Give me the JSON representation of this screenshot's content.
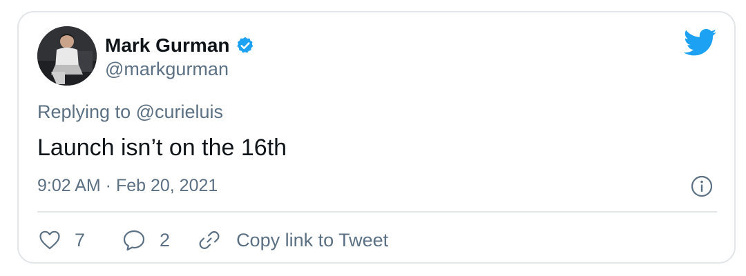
{
  "user": {
    "display_name": "Mark Gurman",
    "handle": "@markgurman",
    "verified": true,
    "avatar": "person-photo"
  },
  "tweet": {
    "replying_to": "Replying to @curieluis",
    "text": "Launch isn’t on the 16th",
    "timestamp": "9:02 AM · Feb 20, 2021"
  },
  "actions": {
    "likes": "7",
    "replies": "2",
    "copy_link": "Copy link to Tweet"
  },
  "icons": {
    "brand": "twitter-bird-icon",
    "verified": "verified-badge-icon",
    "info": "info-icon",
    "like": "heart-icon",
    "reply": "comment-icon",
    "link": "link-icon"
  },
  "colors": {
    "brand_blue": "#1da1f2",
    "text_primary": "#0f1419",
    "text_secondary": "#5b7083",
    "border": "#e3e6e8"
  }
}
